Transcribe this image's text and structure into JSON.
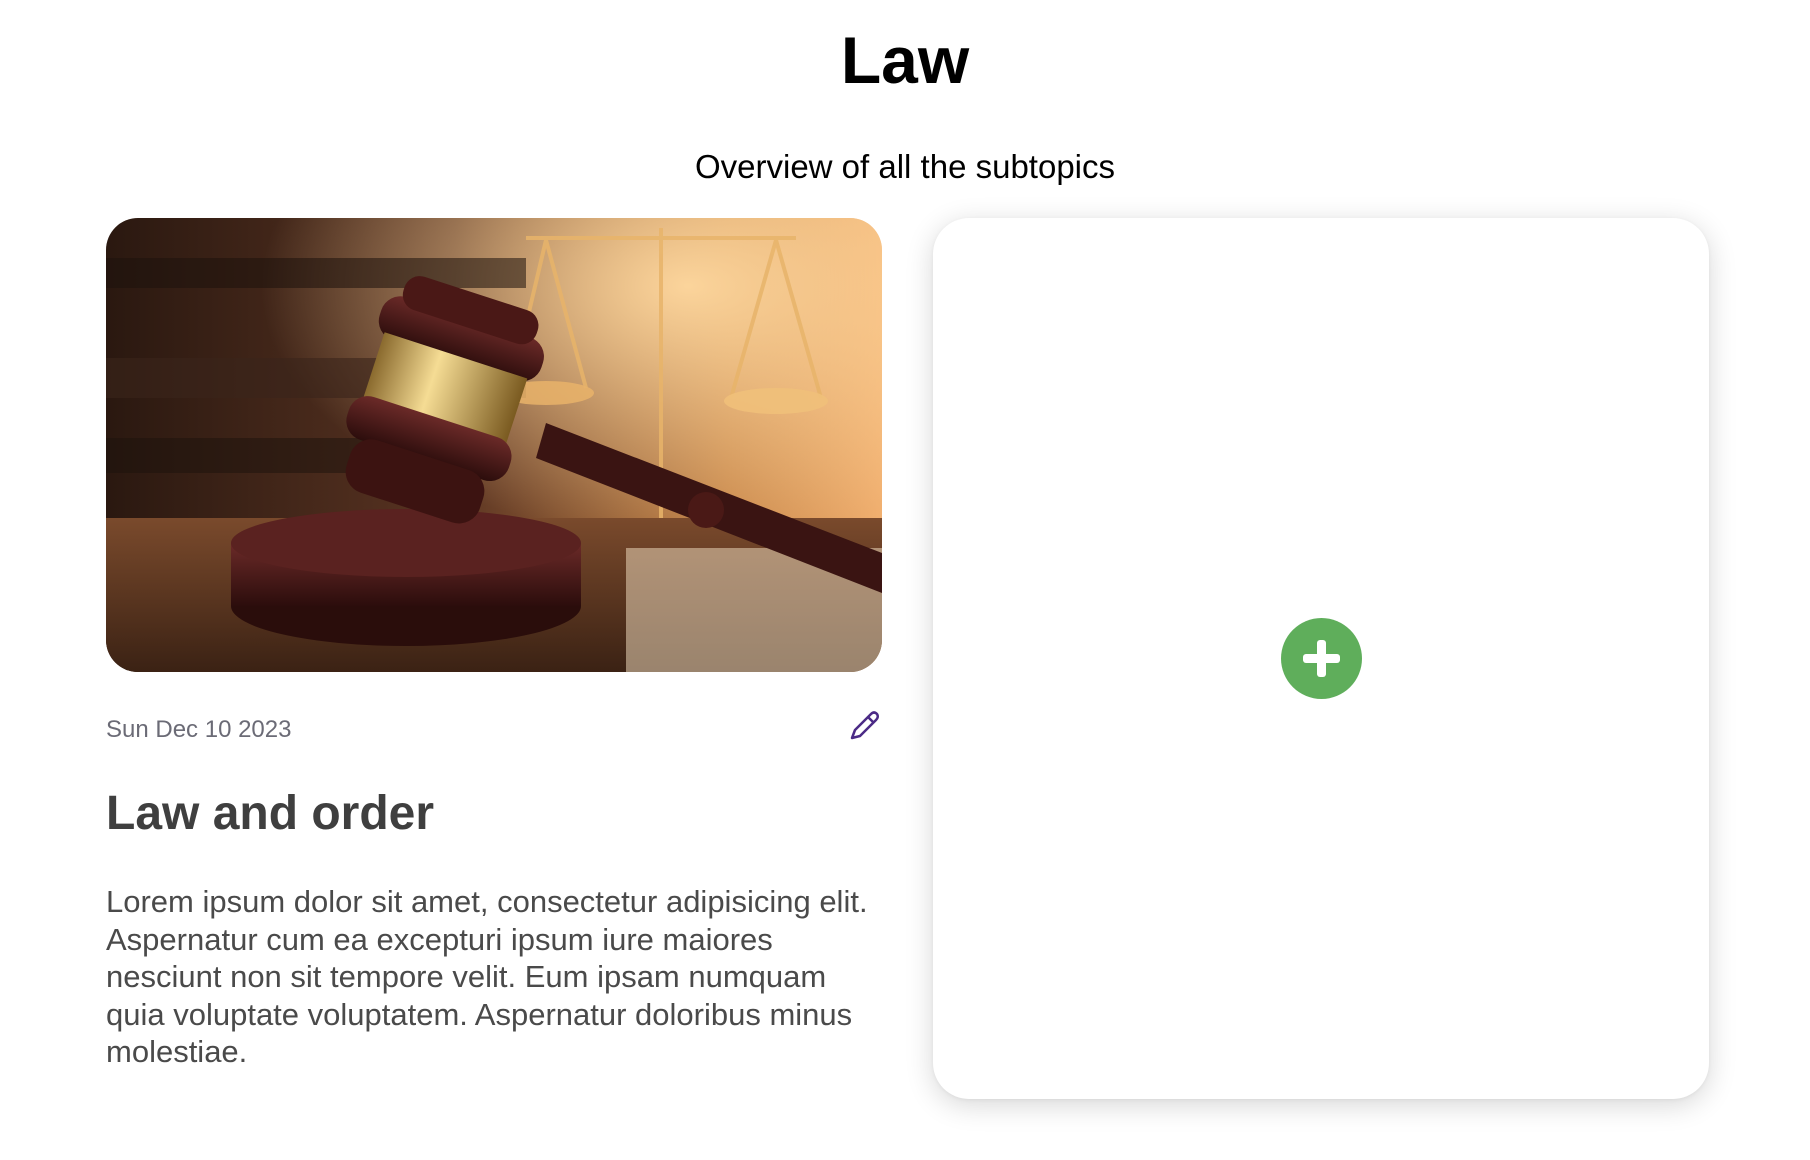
{
  "header": {
    "title": "Law",
    "subtitle": "Overview of all the subtopics"
  },
  "topics": [
    {
      "image": "gavel-and-scales-of-justice-photo",
      "date": "Sun Dec 10 2023",
      "title": "Law and order",
      "description": "Lorem ipsum dolor sit amet, consectetur adipisicing elit. Aspernatur cum ea excepturi ipsum iure maiores nesciunt non sit tempore velit. Eum ipsam numquam quia voluptate voluptatem. Aspernatur doloribus minus molestiae.",
      "edit_icon": "pencil-icon"
    }
  ],
  "add_card": {
    "icon": "plus-circle-icon"
  },
  "colors": {
    "accent_green": "#5fae5b",
    "edit_purple": "#4b2a86",
    "date_gray": "#6b6b76",
    "text_dark": "#3f3f3f"
  }
}
